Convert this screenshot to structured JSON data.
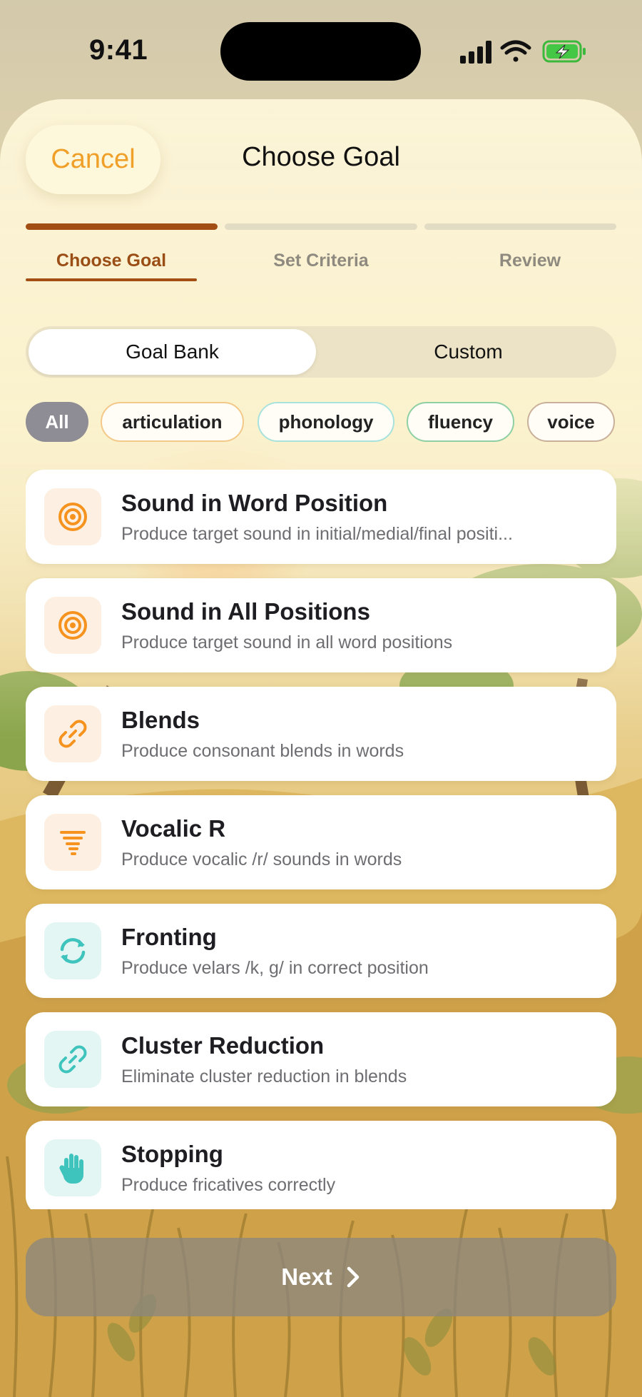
{
  "status_bar": {
    "time": "9:41"
  },
  "header": {
    "cancel_label": "Cancel",
    "title": "Choose Goal"
  },
  "steps": [
    "Choose Goal",
    "Set Criteria",
    "Review"
  ],
  "active_step": 0,
  "source_toggle": {
    "options": [
      "Goal Bank",
      "Custom"
    ],
    "selected": "Goal Bank"
  },
  "filters": [
    "All",
    "articulation",
    "phonology",
    "fluency",
    "voice"
  ],
  "selected_filter": "All",
  "goals": [
    {
      "title": "Sound in Word Position",
      "description": "Produce target sound in initial/medial/final positi...",
      "icon": "target-icon",
      "color": "#f5931e"
    },
    {
      "title": "Sound in All Positions",
      "description": "Produce target sound in all word positions",
      "icon": "target-icon",
      "color": "#f5931e"
    },
    {
      "title": "Blends",
      "description": "Produce consonant blends in words",
      "icon": "link-icon",
      "color": "#f5931e"
    },
    {
      "title": "Vocalic R",
      "description": "Produce vocalic /r/ sounds in words",
      "icon": "tornado-icon",
      "color": "#f5931e"
    },
    {
      "title": "Fronting",
      "description": "Produce velars /k, g/ in correct position",
      "icon": "refresh-icon",
      "color": "#3fc4bd"
    },
    {
      "title": "Cluster Reduction",
      "description": "Eliminate cluster reduction in blends",
      "icon": "link-icon",
      "color": "#3fc4bd"
    },
    {
      "title": "Stopping",
      "description": "Produce fricatives correctly",
      "icon": "hand-icon",
      "color": "#3fc4bd"
    }
  ],
  "footer": {
    "next_label": "Next"
  },
  "colors": {
    "accent_orange": "#f0a028",
    "step_active": "#a24e14",
    "articulation": "#f5931e",
    "phonology": "#3fc4bd"
  }
}
